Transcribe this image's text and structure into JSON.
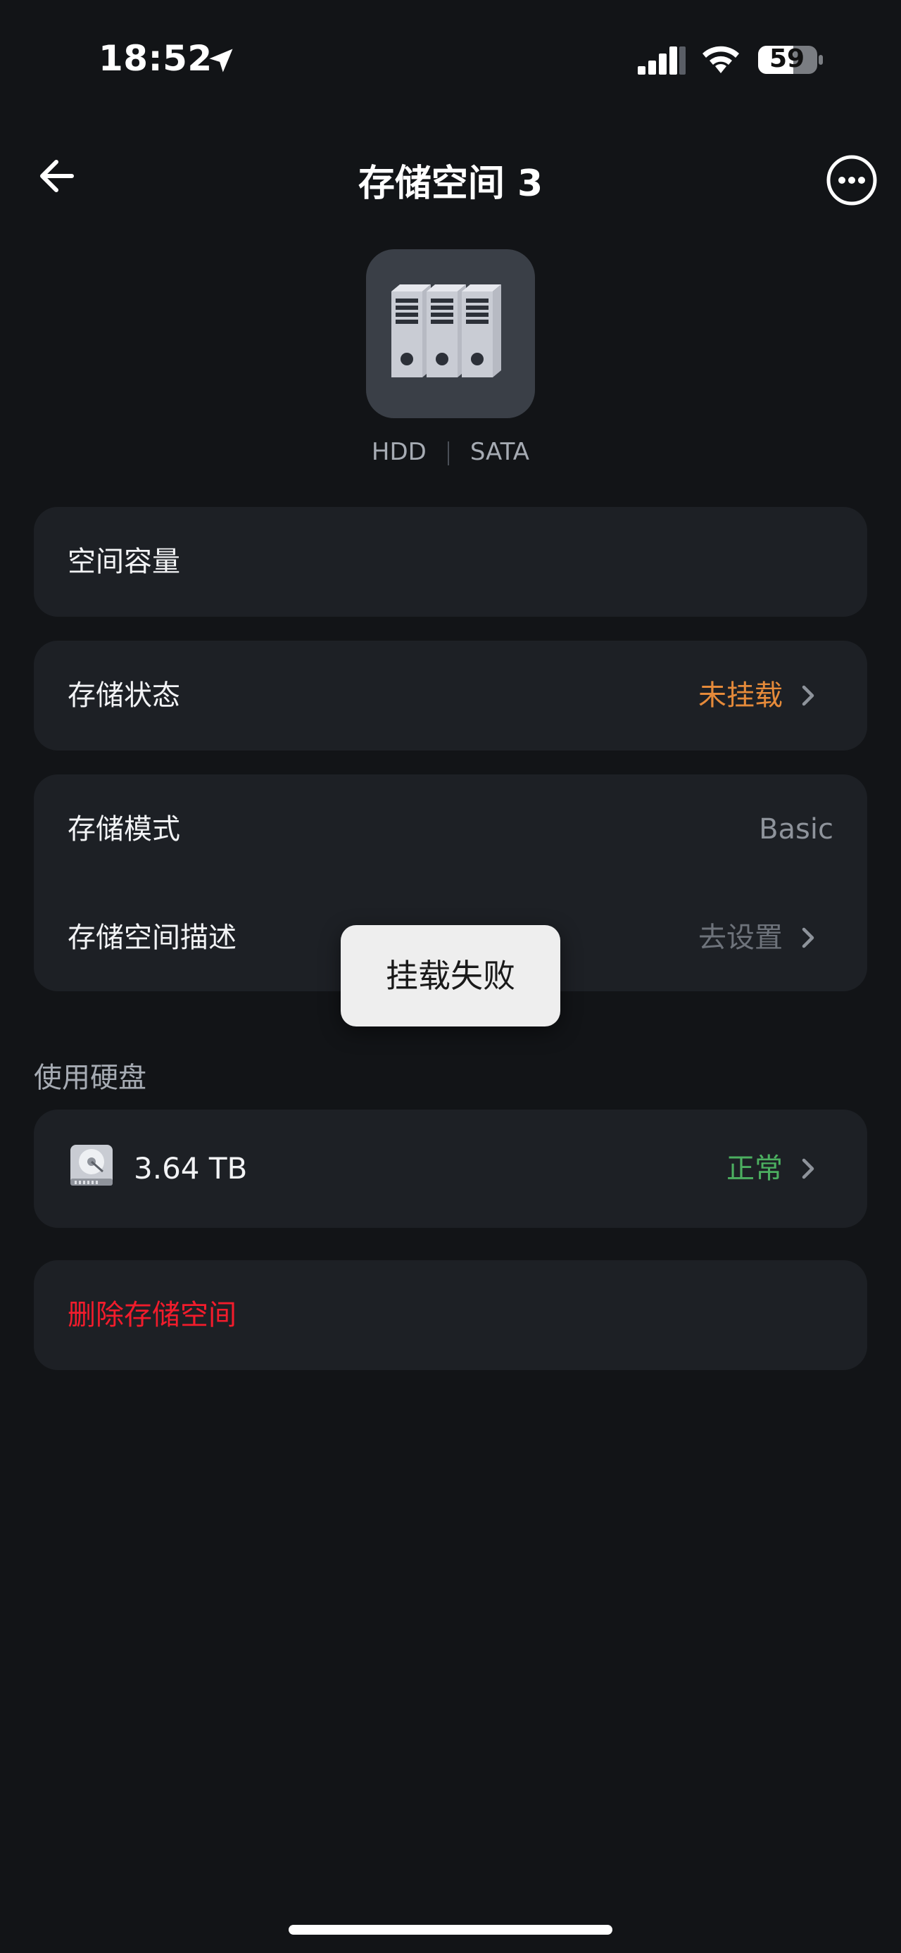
{
  "status_bar": {
    "time": "18:52",
    "battery": "59"
  },
  "nav": {
    "title": "存储空间 3"
  },
  "header": {
    "disk_type": "HDD",
    "interface": "SATA"
  },
  "capacity_card": {
    "label": "空间容量"
  },
  "status_card": {
    "label": "存储状态",
    "value": "未挂载",
    "value_color": "#e58a3a"
  },
  "mode_card": {
    "mode_label": "存储模式",
    "mode_value": "Basic",
    "desc_label": "存储空间描述",
    "desc_value": "去设置"
  },
  "disks_section": {
    "title": "使用硬盘",
    "disks": [
      {
        "size": "3.64 TB",
        "status": "正常",
        "status_color": "#4caf60"
      }
    ]
  },
  "delete": {
    "label": "删除存储空间",
    "color": "#f21c2c"
  },
  "toast": {
    "message": "挂载失败"
  },
  "icons": {
    "back": "arrow-left-icon",
    "more": "more-circle-icon",
    "location": "location-arrow-icon",
    "signal": "cellular-signal-icon",
    "wifi": "wifi-icon",
    "battery": "battery-icon",
    "storage": "server-binders-icon",
    "hdd": "hard-drive-icon",
    "chevron": "chevron-right-icon"
  }
}
